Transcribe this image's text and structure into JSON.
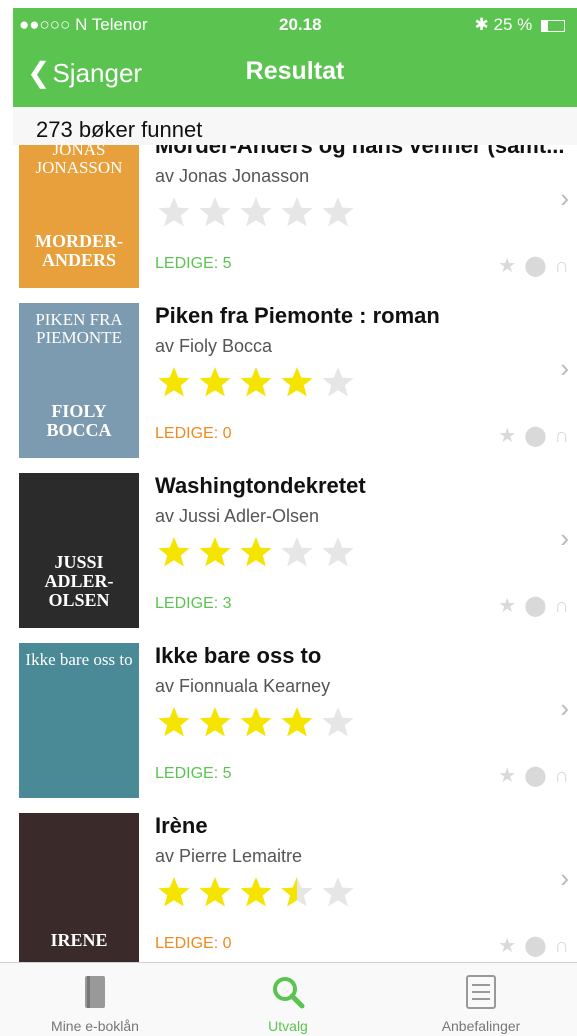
{
  "status": {
    "carrier": "●●○○○ N Telenor",
    "time": "20.18",
    "battery": "25 %"
  },
  "nav": {
    "back_label": "Sjanger",
    "title": "Resultat"
  },
  "result_count": "273 bøker funnet",
  "books": [
    {
      "title": "Morder-Anders og hans venner (samt...",
      "author": "av Jonas Jonasson",
      "rating": 0,
      "availability": "LEDIGE: 5",
      "avail_color": "#5bc451",
      "cover_text_top": "JONAS JONASSON",
      "cover_text": "MORDER-ANDERS",
      "cover_bg": "#e8a03c"
    },
    {
      "title": "Piken fra Piemonte : roman",
      "author": "av Fioly Bocca",
      "rating": 4,
      "availability": "LEDIGE: 0",
      "avail_color": "#f0891e",
      "cover_text_top": "PIKEN FRA PIEMONTE",
      "cover_text": "FIOLY BOCCA",
      "cover_bg": "#7c9bb0"
    },
    {
      "title": "Washingtondekretet",
      "author": "av Jussi Adler-Olsen",
      "rating": 3,
      "availability": "LEDIGE: 3",
      "avail_color": "#5bc451",
      "cover_text_top": "",
      "cover_text": "JUSSI ADLER-OLSEN",
      "cover_bg": "#2b2b2b"
    },
    {
      "title": "Ikke bare oss to",
      "author": "av Fionnuala Kearney",
      "rating": 4,
      "availability": "LEDIGE: 5",
      "avail_color": "#5bc451",
      "cover_text_top": "Ikke bare oss to",
      "cover_text": "",
      "cover_bg": "#4a8a96"
    },
    {
      "title": "Irène",
      "author": "av Pierre Lemaitre",
      "rating": 3.5,
      "availability": "LEDIGE: 0",
      "avail_color": "#f0891e",
      "cover_text_top": "",
      "cover_text": "IRENE",
      "cover_bg": "#3a2a2a"
    }
  ],
  "tabs": [
    {
      "label": "Mine e-boklån",
      "icon": "book-icon",
      "active": false
    },
    {
      "label": "Utvalg",
      "icon": "search-icon",
      "active": true
    },
    {
      "label": "Anbefalinger",
      "icon": "list-icon",
      "active": false
    }
  ],
  "colors": {
    "accent": "#5bc451",
    "star_on": "#f5e400",
    "star_off": "#e6e6e6"
  }
}
